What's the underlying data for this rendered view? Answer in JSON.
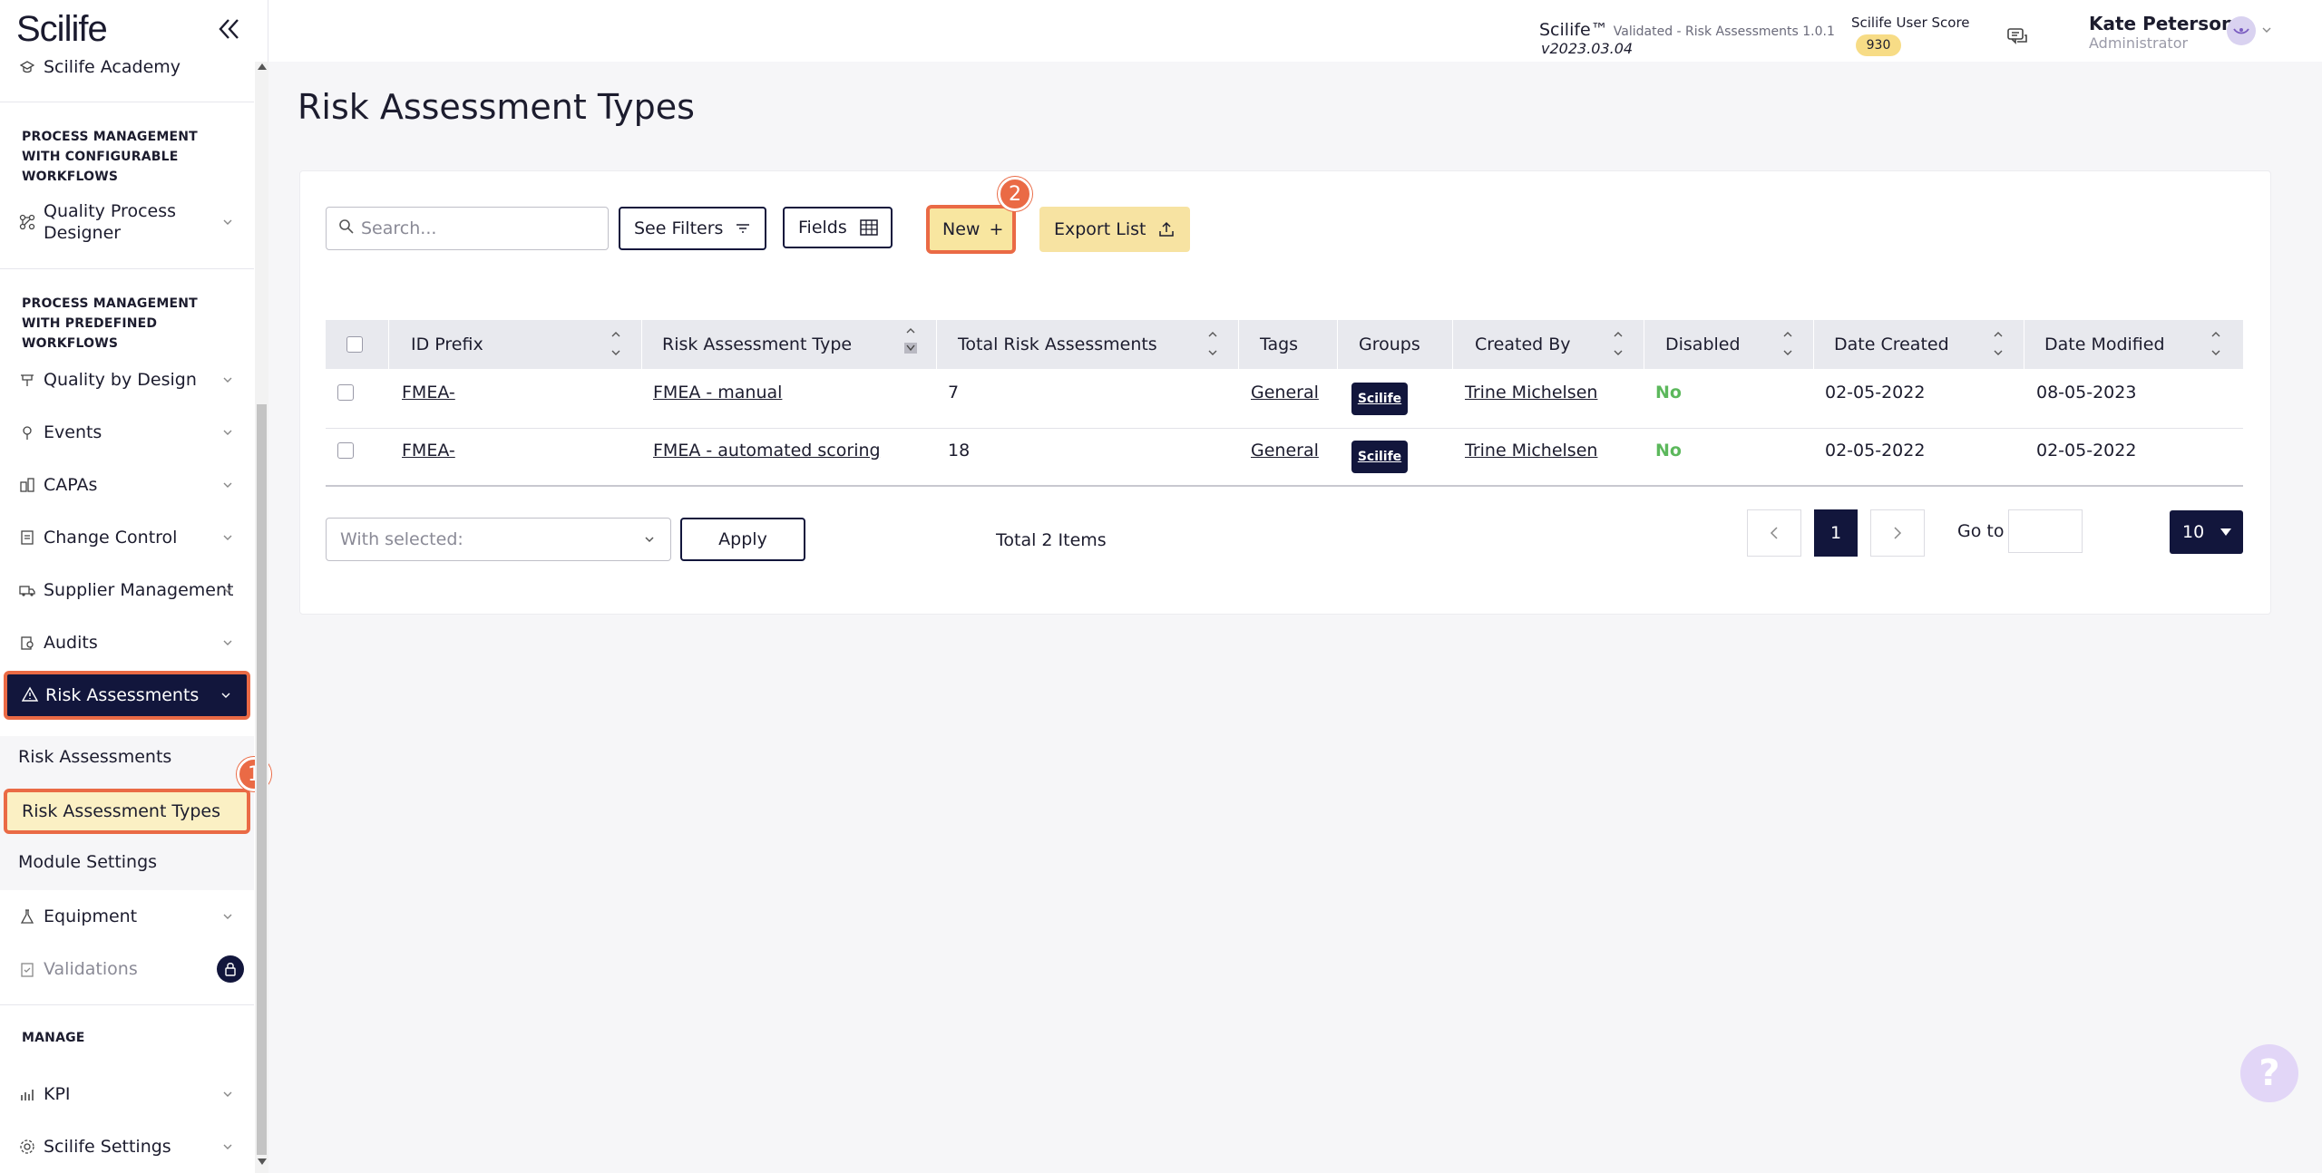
{
  "brand": {
    "logo": "Scilife"
  },
  "header": {
    "app_name": "Scilife™",
    "app_subtitle": "Validated - Risk Assessments 1.0.1",
    "version": "v2023.03.04",
    "score_label": "Scilife User Score",
    "score_value": "930",
    "user_name": "Kate Peterson",
    "user_role": "Administrator"
  },
  "sidebar": {
    "academy": "Scilife Academy",
    "section_configurable": "PROCESS MANAGEMENT WITH CONFIGURABLE WORKFLOWS",
    "quality_process_designer": "Quality Process Designer",
    "section_predefined": "PROCESS MANAGEMENT WITH PREDEFINED WORKFLOWS",
    "quality_by_design": "Quality by Design",
    "events": "Events",
    "capas": "CAPAs",
    "change_control": "Change Control",
    "supplier_management": "Supplier Management",
    "audits": "Audits",
    "risk_assessments": "Risk Assessments",
    "sub_risk_assessments": "Risk Assessments",
    "sub_risk_assessment_types": "Risk Assessment Types",
    "sub_module_settings": "Module Settings",
    "equipment": "Equipment",
    "validations": "Validations",
    "section_manage": "MANAGE",
    "kpi": "KPI",
    "scilife_settings": "Scilife Settings"
  },
  "steps": {
    "one": "1",
    "two": "2"
  },
  "page": {
    "title": "Risk Assessment Types"
  },
  "toolbar": {
    "search_placeholder": "Search...",
    "see_filters": "See Filters",
    "fields": "Fields",
    "new": "New",
    "new_plus": "+",
    "export_list": "Export List"
  },
  "table": {
    "headers": [
      "ID Prefix",
      "Risk Assessment Type",
      "Total Risk Assessments",
      "Tags",
      "Groups",
      "Created By",
      "Disabled",
      "Date Created",
      "Date Modified"
    ],
    "rows": [
      {
        "id_prefix": "FMEA-",
        "type": "FMEA - manual",
        "total": "7",
        "tags": "General",
        "group": "Scilife",
        "created_by": "Trine Michelsen",
        "disabled": "No",
        "date_created": "02-05-2022",
        "date_modified": "08-05-2023"
      },
      {
        "id_prefix": "FMEA-",
        "type": "FMEA - automated scoring",
        "total": "18",
        "tags": "General",
        "group": "Scilife",
        "created_by": "Trine Michelsen",
        "disabled": "No",
        "date_created": "02-05-2022",
        "date_modified": "02-05-2022"
      }
    ]
  },
  "footer": {
    "with_selected": "With selected:",
    "apply": "Apply",
    "total_items": "Total 2 Items",
    "current_page": "1",
    "go_to": "Go to",
    "page_size": "10"
  },
  "help": {
    "label": "?"
  },
  "colors": {
    "navy": "#12163c",
    "accent": "#ea6a45",
    "yellow": "#f8e6a0",
    "success": "#5cb85c"
  }
}
